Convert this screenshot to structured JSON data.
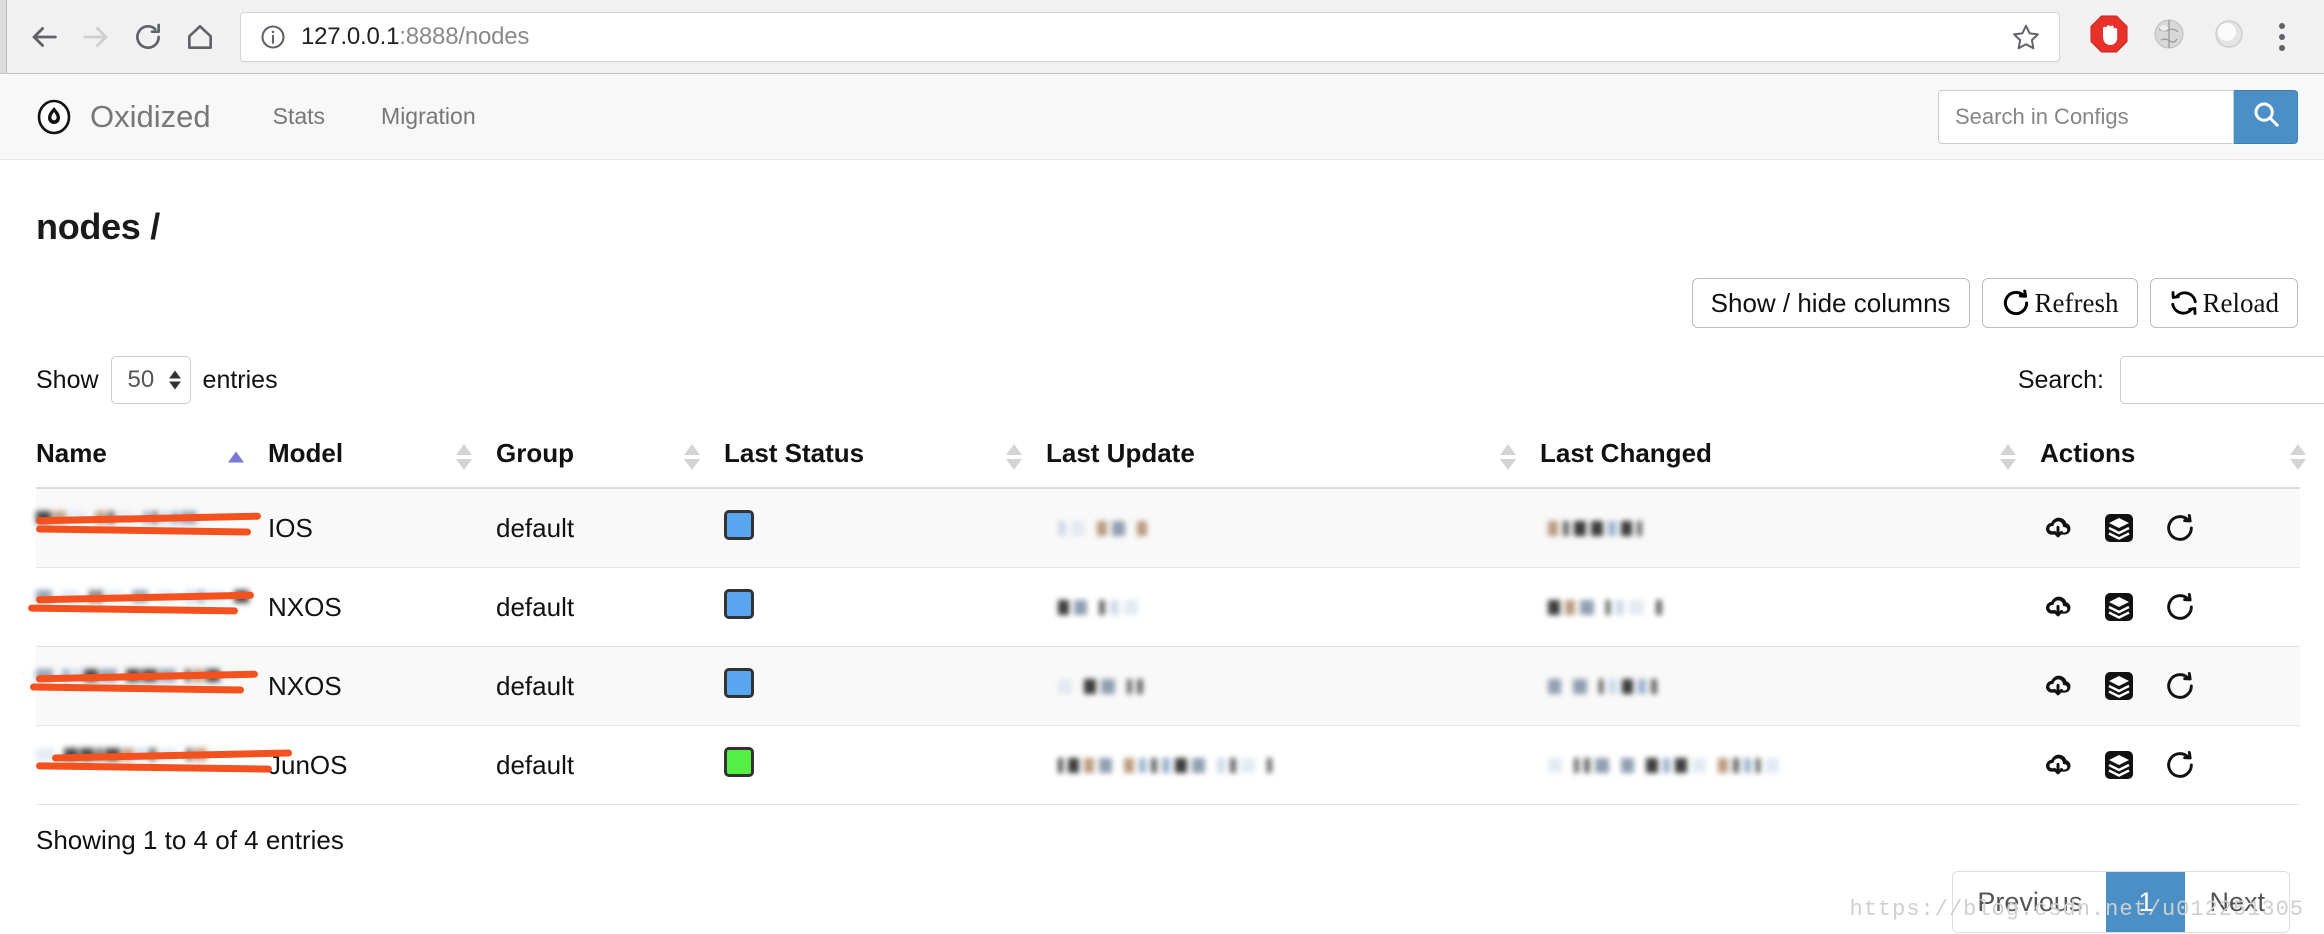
{
  "browser": {
    "back_icon": "arrow-left-icon",
    "forward_icon": "arrow-right-icon",
    "reload_icon": "reload-icon",
    "home_icon": "home-icon",
    "info_icon": "info-circle-icon",
    "url_host": "127.0.0.1",
    "url_rest": ":8888/nodes",
    "star_icon": "bookmark-star-icon",
    "extensions": [
      "adblock-icon",
      "globe-icon",
      "profile-avatar-icon"
    ],
    "menu_icon": "kebab-menu-icon"
  },
  "navbar": {
    "logo_icon": "oxidized-flame-logo-icon",
    "brand": "Oxidized",
    "links": [
      "Stats",
      "Migration"
    ],
    "search_placeholder": "Search in Configs",
    "search_value": "",
    "search_icon": "magnifier-icon",
    "search_button_color": "#4a90c6"
  },
  "page": {
    "title": "nodes /",
    "toolbar": {
      "show_hide_columns": "Show / hide columns",
      "refresh": "Refresh",
      "refresh_icon": "circular-arrow-icon",
      "reload": "Reload",
      "reload_icon": "double-circular-arrow-icon"
    },
    "length": {
      "prefix": "Show",
      "value": "50",
      "suffix": "entries"
    },
    "filter": {
      "label": "Search:",
      "value": "",
      "placeholder": ""
    },
    "table": {
      "columns": [
        {
          "label": "Name",
          "sort": "asc"
        },
        {
          "label": "Model",
          "sort": "none"
        },
        {
          "label": "Group",
          "sort": "none"
        },
        {
          "label": "Last Status",
          "sort": "none"
        },
        {
          "label": "Last Update",
          "sort": "none"
        },
        {
          "label": "Last Changed",
          "sort": "none"
        },
        {
          "label": "Actions",
          "sort": "none"
        }
      ],
      "rows": [
        {
          "name": "[redacted]",
          "model": "IOS",
          "group": "default",
          "status_color": "#5aa5f0",
          "last_update": "[blurred]",
          "last_changed": "[blurred]"
        },
        {
          "name": "[redacted]",
          "model": "NXOS",
          "group": "default",
          "status_color": "#5aa5f0",
          "last_update": "[blurred]",
          "last_changed": "[blurred]"
        },
        {
          "name": "[redacted]",
          "model": "NXOS",
          "group": "default",
          "status_color": "#5aa5f0",
          "last_update": "[blurred]",
          "last_changed": "[blurred]"
        },
        {
          "name": "[redacted]",
          "model": "JunOS",
          "group": "default",
          "status_color": "#55ee44",
          "last_update": "[blurred]",
          "last_changed": "[blurred]"
        }
      ],
      "action_icons": [
        "cloud-download-icon",
        "layers-stack-icon",
        "refresh-icon"
      ]
    },
    "showing_info": "Showing 1 to 4 of 4 entries",
    "pagination": {
      "previous": "Previous",
      "pages": [
        "1"
      ],
      "active_page": "1",
      "next": "Next",
      "active_color": "#4a90c6"
    },
    "watermark": "https://blog.csdn.net/u012251305"
  }
}
